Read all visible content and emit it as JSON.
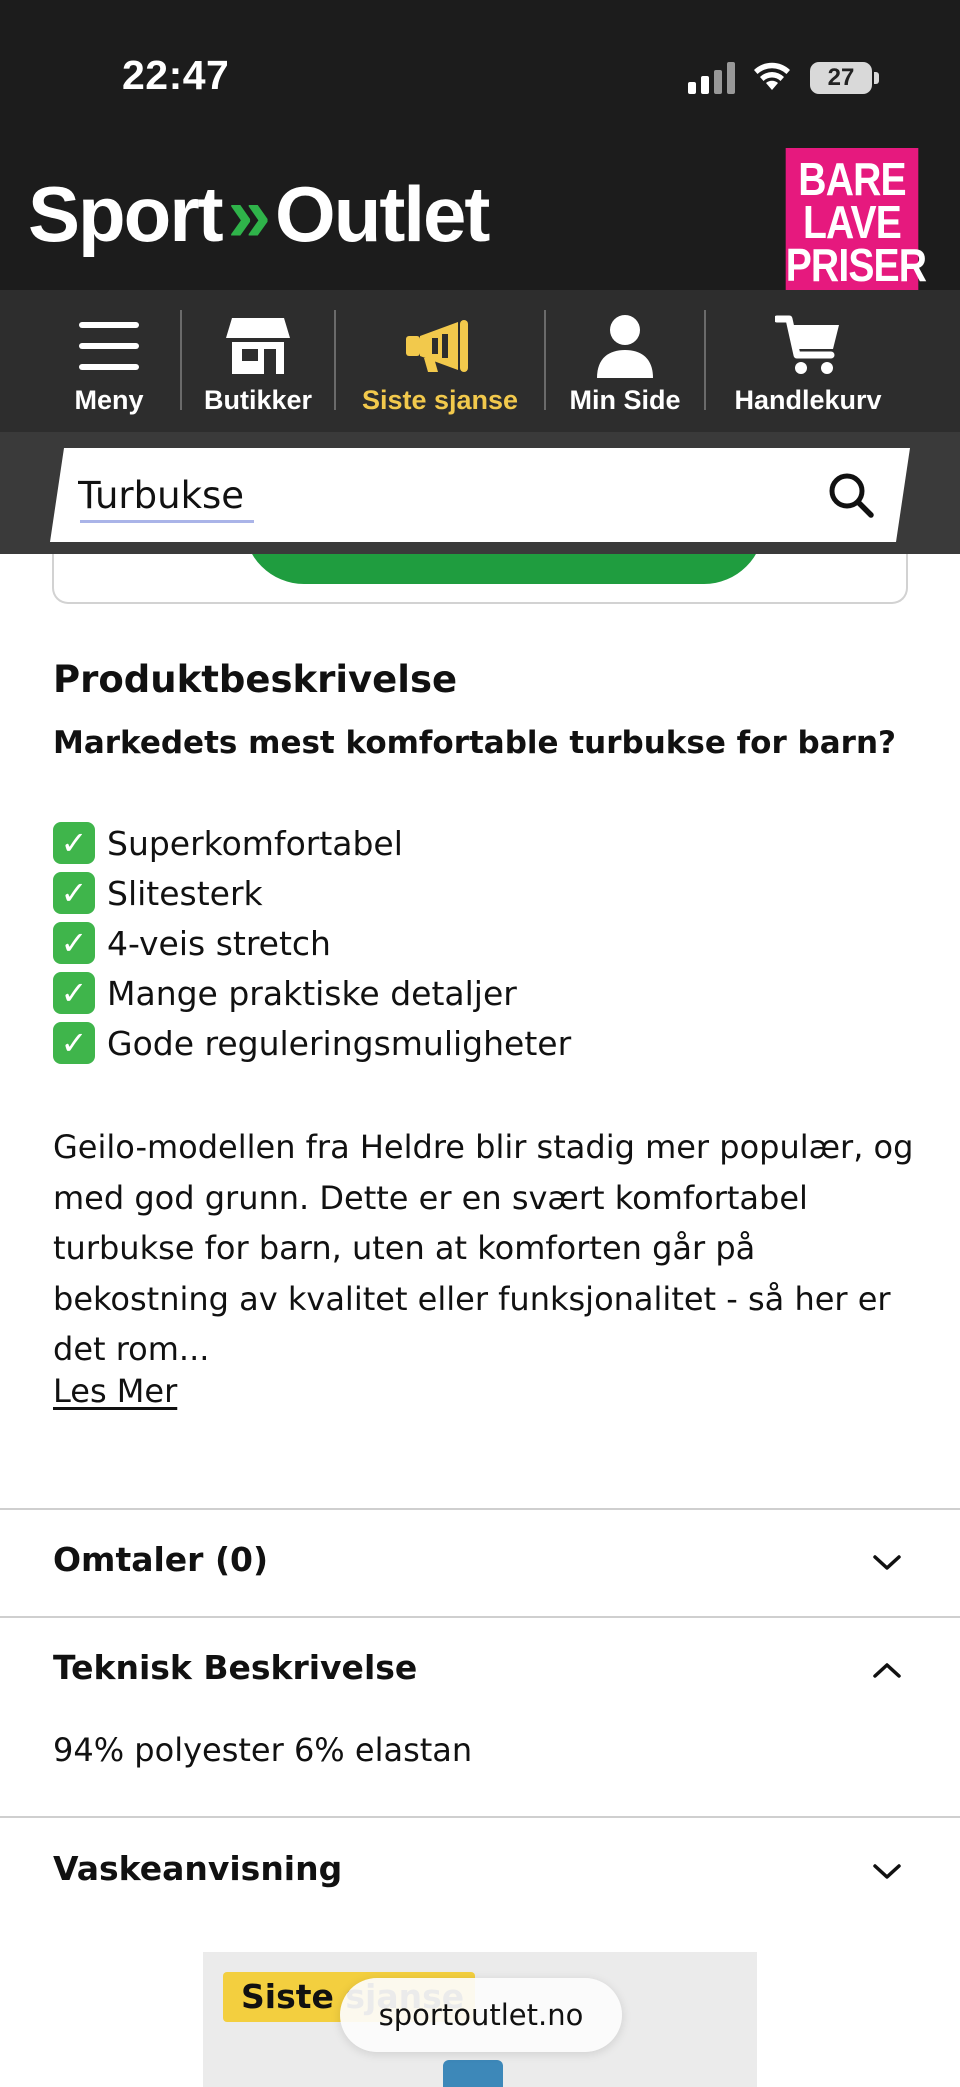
{
  "status_bar": {
    "time": "22:47",
    "battery": "27"
  },
  "header": {
    "logo_left": "Sport",
    "logo_sep": "»",
    "logo_right": "Outlet",
    "badge_lines": [
      "BARE",
      "LAVE",
      "PRISER"
    ]
  },
  "nav": {
    "items": [
      {
        "label": "Meny",
        "icon": "hamburger-icon"
      },
      {
        "label": "Butikker",
        "icon": "store-icon"
      },
      {
        "label": "Siste sjanse",
        "icon": "megaphone-icon",
        "accent": "#f2c94c"
      },
      {
        "label": "Min Side",
        "icon": "user-icon"
      },
      {
        "label": "Handlekurv",
        "icon": "cart-icon"
      }
    ]
  },
  "search": {
    "value": "Turbukse",
    "icon": "search-icon"
  },
  "description": {
    "title": "Produktbeskrivelse",
    "subtitle": "Markedets mest komfortable turbukse for barn?",
    "features": [
      "Superkomfortabel",
      "Slitesterk",
      "4-veis stretch",
      "Mange praktiske detaljer",
      "Gode reguleringsmuligheter"
    ],
    "body": "Geilo-modellen fra Heldre blir stadig mer populær, og med god grunn. Dette er en svært komfortabel turbukse for barn, uten at komforten går på bekostning av kvalitet eller funksjonalitet - så her er det rom...",
    "read_more": "Les Mer"
  },
  "accordions": {
    "reviews": {
      "title": "Omtaler (0)",
      "expanded": false
    },
    "technical": {
      "title": "Teknisk Beskrivelse",
      "expanded": true,
      "content": "94% polyester 6% elastan"
    },
    "washing": {
      "title": "Vaskeanvisning",
      "expanded": false
    }
  },
  "bottom": {
    "sale_label": "Siste sjanse",
    "url": "sportoutlet.no"
  },
  "colors": {
    "dark": "#1c1c1c",
    "nav_bg": "#2d2d2d",
    "accent_yellow": "#f2c94c",
    "badge_pink": "#e6197e",
    "brand_green": "#2fb34a",
    "check_green": "#3fb54b"
  }
}
